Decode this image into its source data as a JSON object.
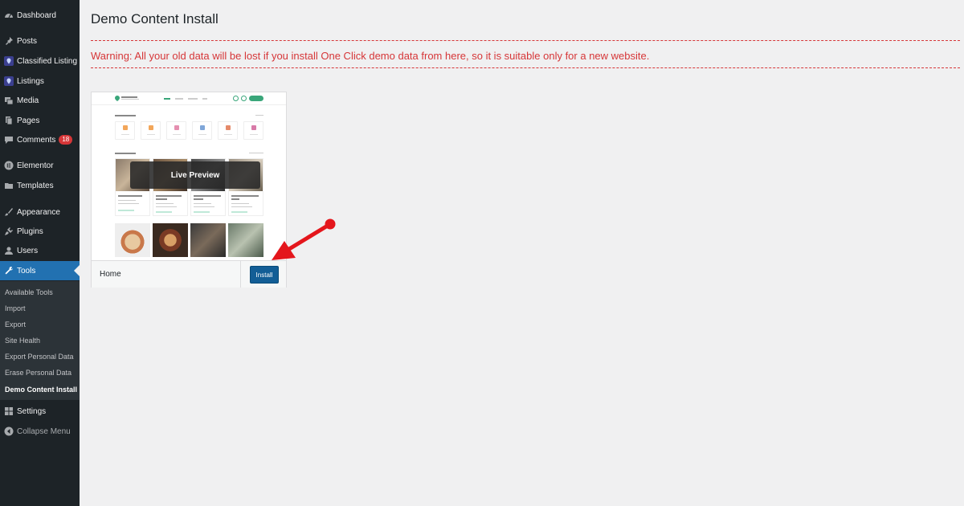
{
  "sidebar": {
    "items": [
      {
        "label": "Dashboard",
        "icon": "dashboard-icon"
      },
      {
        "label": "Posts",
        "icon": "pin-icon"
      },
      {
        "label": "Classified Listing",
        "icon": "map-marker-icon"
      },
      {
        "label": "Listings",
        "icon": "map-marker-icon"
      },
      {
        "label": "Media",
        "icon": "media-icon"
      },
      {
        "label": "Pages",
        "icon": "page-icon"
      },
      {
        "label": "Comments",
        "icon": "comment-icon",
        "badge": "18"
      },
      {
        "label": "Elementor",
        "icon": "elementor-icon"
      },
      {
        "label": "Templates",
        "icon": "folder-icon"
      },
      {
        "label": "Appearance",
        "icon": "brush-icon"
      },
      {
        "label": "Plugins",
        "icon": "plug-icon"
      },
      {
        "label": "Users",
        "icon": "user-icon"
      },
      {
        "label": "Tools",
        "icon": "wrench-icon"
      },
      {
        "label": "Settings",
        "icon": "settings-icon"
      },
      {
        "label": "Collapse Menu",
        "icon": "collapse-icon"
      }
    ],
    "submenu": [
      "Available Tools",
      "Import",
      "Export",
      "Site Health",
      "Export Personal Data",
      "Erase Personal Data",
      "Demo Content Install"
    ]
  },
  "page": {
    "title": "Demo Content Install",
    "warning": "Warning: All your old data will be lost if you install One Click demo data from here, so it is suitable only for a new website."
  },
  "demo": {
    "name": "Home",
    "install_label": "Install",
    "preview_label": "Live Preview"
  },
  "colors": {
    "sidebar_bg": "#1d2327",
    "active": "#2271b1",
    "warning": "#d63638",
    "install_button": "#135e96"
  }
}
